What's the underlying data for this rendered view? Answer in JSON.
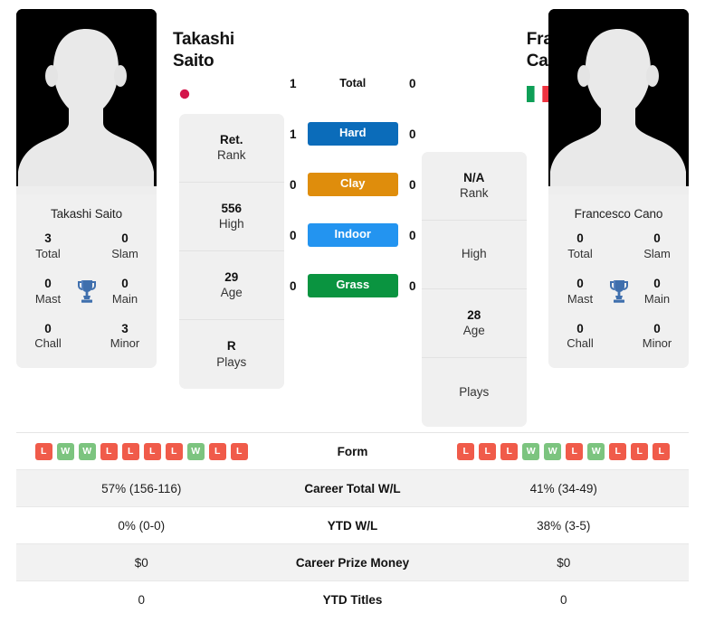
{
  "colors": {
    "hard": "#0b6cba",
    "clay": "#df8d0c",
    "indoor": "#2394f0",
    "grass": "#0a9440",
    "win": "#7cc47f",
    "loss": "#f05b4a",
    "trophy": "#3f6fad",
    "panel": "#f0f0f0"
  },
  "left_player": {
    "name": "Takashi Saito",
    "flag": "japan-flag",
    "card_name": "Takashi Saito",
    "titles": [
      [
        {
          "value": "3",
          "label": "Total"
        },
        {
          "value": "0",
          "label": "Slam"
        }
      ],
      [
        {
          "value": "0",
          "label": "Mast"
        },
        {
          "value": "0",
          "label": "Main"
        }
      ],
      [
        {
          "value": "0",
          "label": "Chall"
        },
        {
          "value": "3",
          "label": "Minor"
        }
      ]
    ],
    "info": [
      {
        "value": "Ret.",
        "label": "Rank"
      },
      {
        "value": "556",
        "label": "High"
      },
      {
        "value": "29",
        "label": "Age"
      },
      {
        "value": "R",
        "label": "Plays"
      }
    ],
    "form": [
      "L",
      "W",
      "W",
      "L",
      "L",
      "L",
      "L",
      "W",
      "L",
      "L"
    ],
    "career_total_wl": "57% (156-116)",
    "ytd_wl": "0% (0-0)",
    "career_prize_money": "$0",
    "ytd_titles": "0"
  },
  "right_player": {
    "name": "Francesco Cano",
    "flag": "italy-flag",
    "card_name": "Francesco Cano",
    "titles": [
      [
        {
          "value": "0",
          "label": "Total"
        },
        {
          "value": "0",
          "label": "Slam"
        }
      ],
      [
        {
          "value": "0",
          "label": "Mast"
        },
        {
          "value": "0",
          "label": "Main"
        }
      ],
      [
        {
          "value": "0",
          "label": "Chall"
        },
        {
          "value": "0",
          "label": "Minor"
        }
      ]
    ],
    "info": [
      {
        "value": "N/A",
        "label": "Rank"
      },
      {
        "value": "",
        "label": "High"
      },
      {
        "value": "28",
        "label": "Age"
      },
      {
        "value": "",
        "label": "Plays"
      }
    ],
    "form": [
      "L",
      "L",
      "L",
      "W",
      "W",
      "L",
      "W",
      "L",
      "L",
      "L"
    ],
    "career_total_wl": "41% (34-49)",
    "ytd_wl": "38% (3-5)",
    "career_prize_money": "$0",
    "ytd_titles": "0"
  },
  "h2h": {
    "total_label": "Total",
    "rows": [
      {
        "label": "Total",
        "left": "1",
        "right": "0",
        "badge": false,
        "color": ""
      },
      {
        "label": "Hard",
        "left": "1",
        "right": "0",
        "badge": true,
        "color": "#0b6cba"
      },
      {
        "label": "Clay",
        "left": "0",
        "right": "0",
        "badge": true,
        "color": "#df8d0c"
      },
      {
        "label": "Indoor",
        "left": "0",
        "right": "0",
        "badge": true,
        "color": "#2394f0"
      },
      {
        "label": "Grass",
        "left": "0",
        "right": "0",
        "badge": true,
        "color": "#0a9440"
      }
    ]
  },
  "table": {
    "rows": [
      {
        "label": "Form",
        "type": "form"
      },
      {
        "label": "Career Total W/L",
        "type": "text",
        "left": "57% (156-116)",
        "right": "41% (34-49)"
      },
      {
        "label": "YTD W/L",
        "type": "text",
        "left": "0% (0-0)",
        "right": "38% (3-5)"
      },
      {
        "label": "Career Prize Money",
        "type": "text",
        "left": "$0",
        "right": "$0"
      },
      {
        "label": "YTD Titles",
        "type": "text",
        "left": "0",
        "right": "0"
      }
    ]
  }
}
